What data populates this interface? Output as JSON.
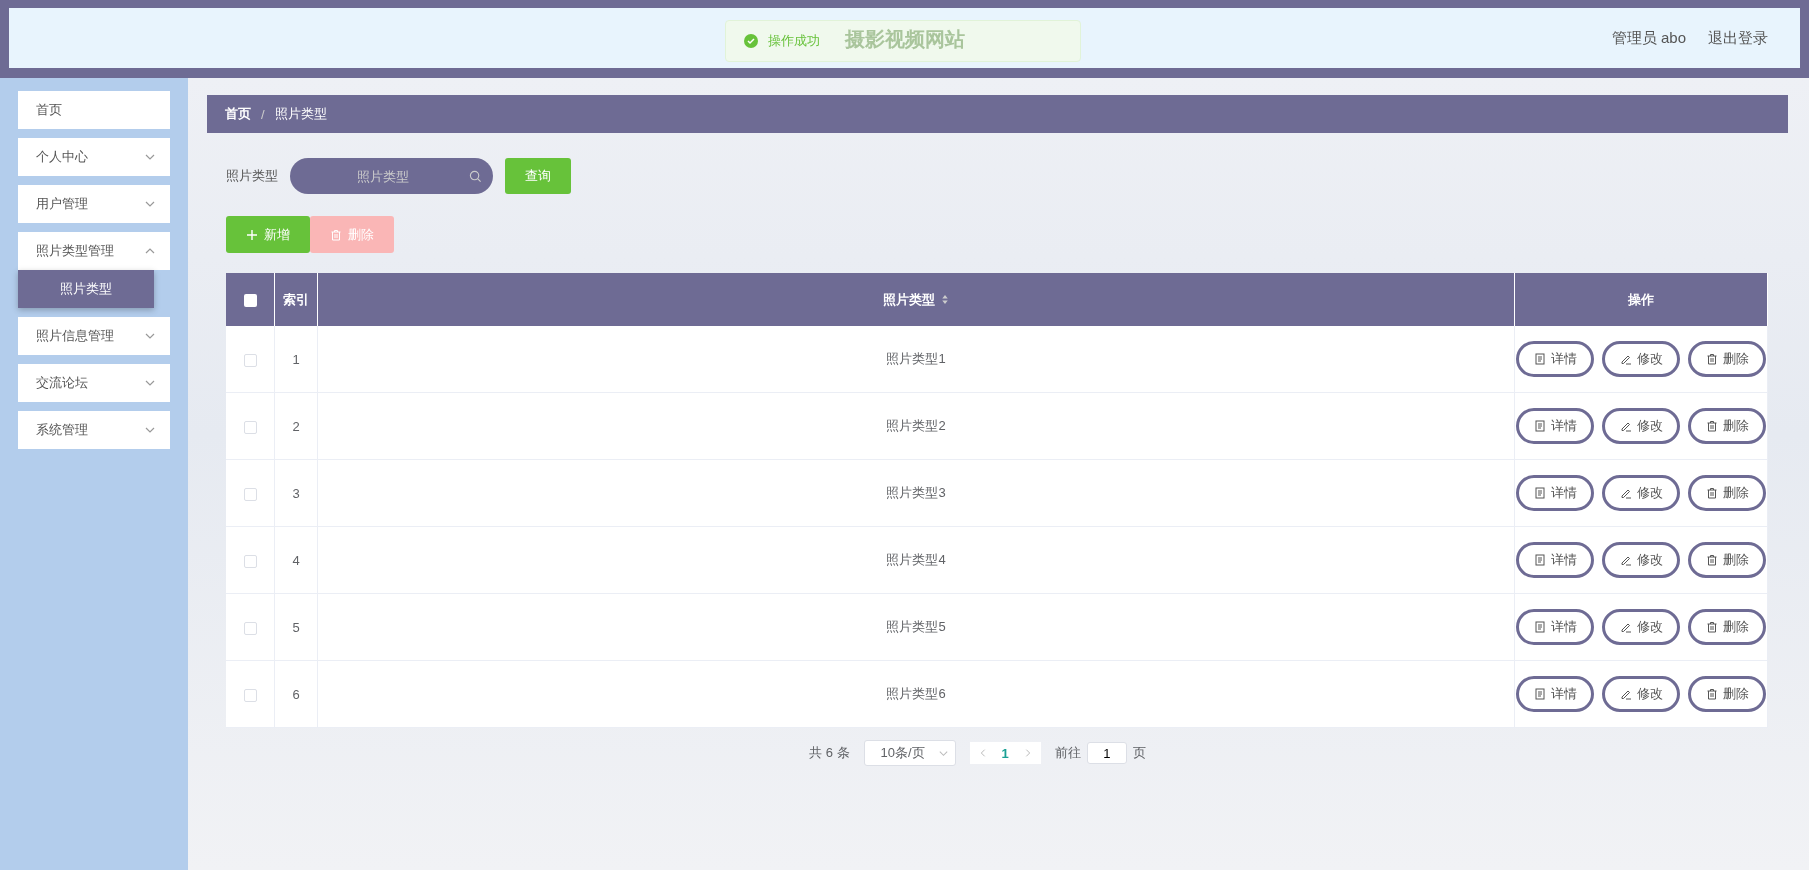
{
  "header": {
    "title": "摄影视频网站",
    "user": "管理员 abo",
    "logout": "退出登录",
    "toast": {
      "text": "操作成功"
    }
  },
  "sidebar": {
    "items": [
      {
        "label": "首页",
        "kind": "link"
      },
      {
        "label": "个人中心",
        "kind": "menu",
        "expanded": false
      },
      {
        "label": "用户管理",
        "kind": "menu",
        "expanded": false
      },
      {
        "label": "照片类型管理",
        "kind": "menu",
        "expanded": true,
        "children": [
          {
            "label": "照片类型",
            "selected": true
          }
        ]
      },
      {
        "label": "照片信息管理",
        "kind": "menu",
        "expanded": false
      },
      {
        "label": "交流论坛",
        "kind": "menu",
        "expanded": false
      },
      {
        "label": "系统管理",
        "kind": "menu",
        "expanded": false
      }
    ]
  },
  "breadcrumb": {
    "items": [
      "首页",
      "照片类型"
    ],
    "separator": "/"
  },
  "search": {
    "label": "照片类型",
    "placeholder": "照片类型",
    "button": "查询"
  },
  "toolbar": {
    "add": "新增",
    "delete": {
      "label": "删除",
      "disabled": true
    }
  },
  "table": {
    "select_all": {
      "checked": false
    },
    "columns": [
      {
        "label": "索引",
        "sortable": false
      },
      {
        "label": "照片类型",
        "sortable": true
      },
      {
        "label": "操作",
        "sortable": false
      }
    ],
    "rows": [
      {
        "checked": false,
        "index": "1",
        "type": "照片类型1",
        "actions": [
          "详情",
          "修改",
          "删除"
        ]
      },
      {
        "checked": false,
        "index": "2",
        "type": "照片类型2",
        "actions": [
          "详情",
          "修改",
          "删除"
        ]
      },
      {
        "checked": false,
        "index": "3",
        "type": "照片类型3",
        "actions": [
          "详情",
          "修改",
          "删除"
        ]
      },
      {
        "checked": false,
        "index": "4",
        "type": "照片类型4",
        "actions": [
          "详情",
          "修改",
          "删除"
        ]
      },
      {
        "checked": false,
        "index": "5",
        "type": "照片类型5",
        "actions": [
          "详情",
          "修改",
          "删除"
        ]
      },
      {
        "checked": false,
        "index": "6",
        "type": "照片类型6",
        "actions": [
          "详情",
          "修改",
          "删除"
        ]
      }
    ]
  },
  "pagination": {
    "total": "共 6 条",
    "page_size": "10条/页",
    "pages": [
      {
        "label": "1",
        "selected": true
      }
    ],
    "goto_label": "前往",
    "goto_value": "1",
    "goto_suffix": "页"
  }
}
